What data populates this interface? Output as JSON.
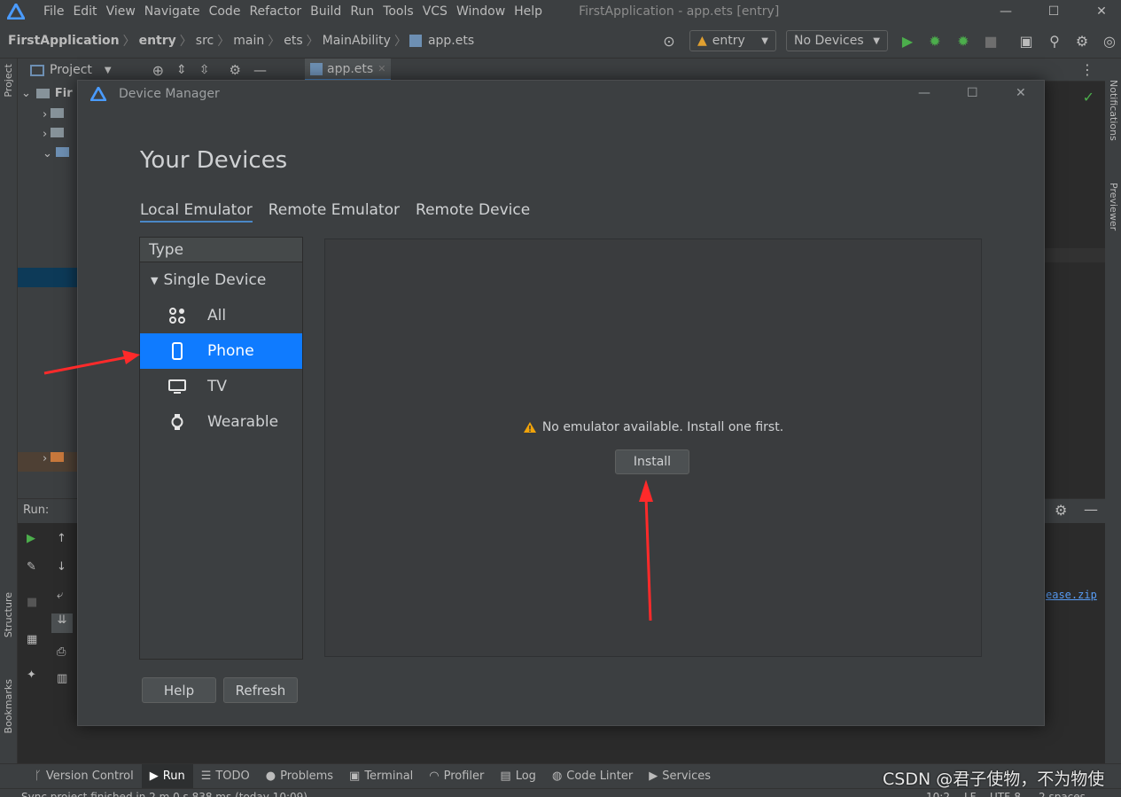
{
  "menu": {
    "items": [
      "File",
      "Edit",
      "View",
      "Navigate",
      "Code",
      "Refactor",
      "Build",
      "Run",
      "Tools",
      "VCS",
      "Window",
      "Help"
    ],
    "window_title": "FirstApplication - app.ets [entry]"
  },
  "breadcrumb": [
    "FirstApplication",
    "entry",
    "src",
    "main",
    "ets",
    "MainAbility",
    "app.ets"
  ],
  "toolbar": {
    "module": "entry",
    "device": "No Devices"
  },
  "project": {
    "label": "Project",
    "root_label": "Fir"
  },
  "editor_tab": "app.ets",
  "side": {
    "left_top": "Project",
    "left_structure": "Structure",
    "left_bookmarks": "Bookmarks",
    "right_notifications": "Notifications",
    "right_previewer": "Previewer"
  },
  "run": {
    "label": "Run:",
    "link_text": "ease.zip"
  },
  "bottom_tabs": [
    "Version Control",
    "Run",
    "TODO",
    "Problems",
    "Terminal",
    "Profiler",
    "Log",
    "Code Linter",
    "Services"
  ],
  "status": {
    "message": "Sync project finished in 2 m 0 s 838 ms (today 10:09)",
    "position": "10:2",
    "line_sep": "LF",
    "encoding": "UTF-8",
    "indent": "2 spaces"
  },
  "watermark": "CSDN @君子使物，不为物使",
  "dialog": {
    "title": "Device Manager",
    "heading": "Your Devices",
    "tabs": [
      "Local Emulator",
      "Remote Emulator",
      "Remote Device"
    ],
    "type_header": "Type",
    "group": "Single Device",
    "types": [
      "All",
      "Phone",
      "TV",
      "Wearable"
    ],
    "selected_type": "Phone",
    "message": "No emulator available. Install one first.",
    "install_label": "Install",
    "help_label": "Help",
    "refresh_label": "Refresh"
  },
  "colors": {
    "accent": "#0f7bff",
    "annotation_arrow": "#ff2a2a",
    "warning": "#f0a30a"
  }
}
